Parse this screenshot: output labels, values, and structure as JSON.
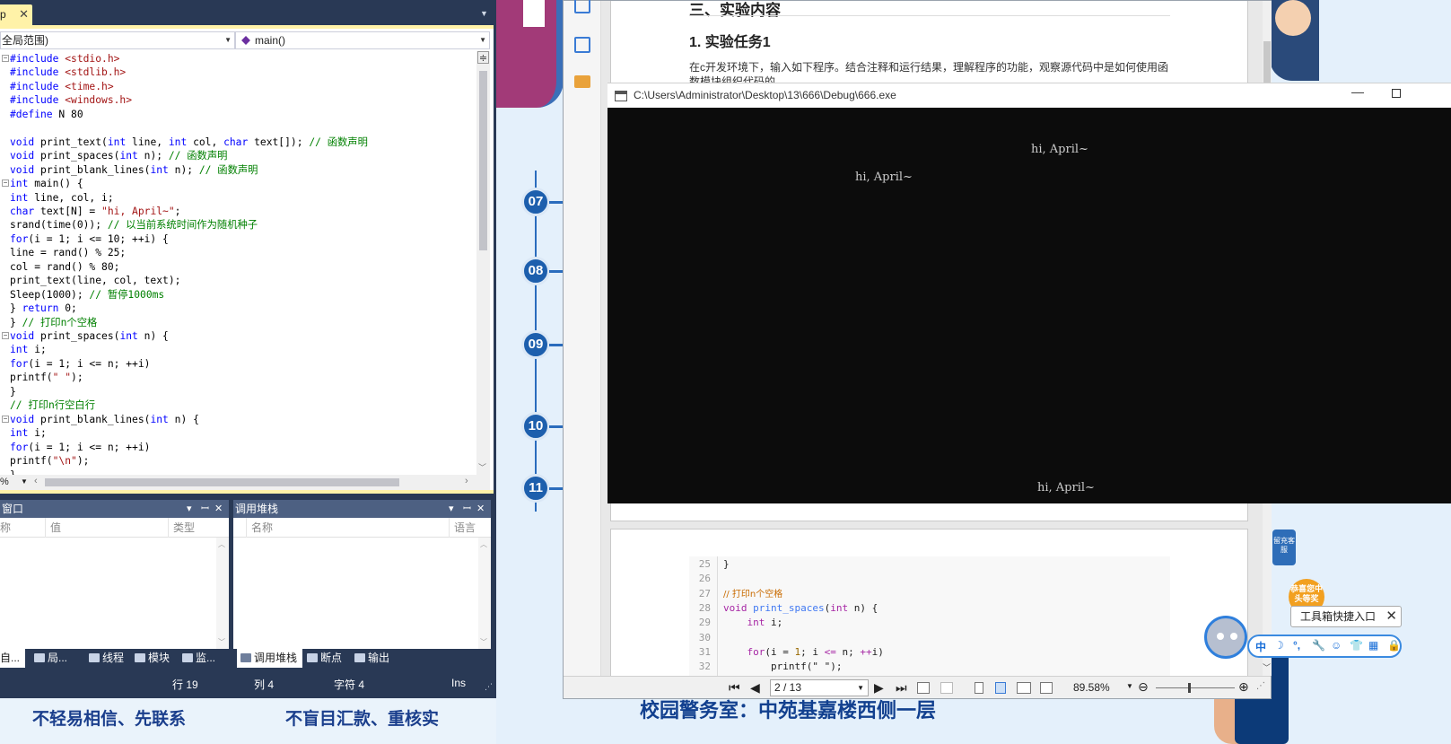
{
  "vs": {
    "tab_label": "p",
    "nav_scope": "全局范围)",
    "nav_function": "main()",
    "zoom": "%",
    "code": [
      {
        "fold": "−",
        "segs": [
          [
            "pp",
            "#include "
          ],
          [
            "str",
            "<stdio.h>"
          ]
        ]
      },
      {
        "segs": [
          [
            "pp",
            "#include "
          ],
          [
            "str",
            "<stdlib.h>"
          ]
        ]
      },
      {
        "segs": [
          [
            "pp",
            "#include "
          ],
          [
            "str",
            "<time.h>"
          ]
        ]
      },
      {
        "segs": [
          [
            "pp",
            "#include "
          ],
          [
            "str",
            "<windows.h>"
          ]
        ]
      },
      {
        "segs": [
          [
            "pp",
            "#define"
          ],
          [
            "",
            " N 80"
          ]
        ]
      },
      {
        "segs": []
      },
      {
        "segs": [
          [
            "kw",
            "void"
          ],
          [
            "",
            " print_text("
          ],
          [
            "kw",
            "int"
          ],
          [
            "",
            " line, "
          ],
          [
            "kw",
            "int"
          ],
          [
            "",
            " col, "
          ],
          [
            "kw",
            "char"
          ],
          [
            "",
            " text[]); "
          ],
          [
            "cm",
            "// 函数声明"
          ]
        ]
      },
      {
        "segs": [
          [
            "kw",
            "void"
          ],
          [
            "",
            " print_spaces("
          ],
          [
            "kw",
            "int"
          ],
          [
            "",
            " n); "
          ],
          [
            "cm",
            "// 函数声明"
          ]
        ]
      },
      {
        "segs": [
          [
            "kw",
            "void"
          ],
          [
            "",
            " print_blank_lines("
          ],
          [
            "kw",
            "int"
          ],
          [
            "",
            " n); "
          ],
          [
            "cm",
            "// 函数声明"
          ]
        ]
      },
      {
        "fold": "−",
        "segs": [
          [
            "kw",
            "int"
          ],
          [
            "",
            " main() {"
          ]
        ]
      },
      {
        "segs": [
          [
            "kw",
            "int"
          ],
          [
            "",
            " line, col, i;"
          ]
        ]
      },
      {
        "segs": [
          [
            "kw",
            "char"
          ],
          [
            "",
            " text[N] = "
          ],
          [
            "str",
            "\"hi, April~\""
          ],
          [
            "",
            ";"
          ]
        ]
      },
      {
        "segs": [
          [
            "",
            "srand(time(0)); "
          ],
          [
            "cm",
            "// 以当前系统时间作为随机种子"
          ]
        ]
      },
      {
        "segs": [
          [
            "kw",
            "for"
          ],
          [
            "",
            "(i = 1; i <= 10; ++i) {"
          ]
        ]
      },
      {
        "segs": [
          [
            "",
            "line = rand() % 25;"
          ]
        ]
      },
      {
        "segs": [
          [
            "",
            "col = rand() % 80;"
          ]
        ]
      },
      {
        "segs": [
          [
            "",
            "print_text(line, col, text);"
          ]
        ]
      },
      {
        "segs": [
          [
            "",
            "Sleep(1000); "
          ],
          [
            "cm",
            "// 暂停1000ms"
          ]
        ]
      },
      {
        "segs": [
          [
            "",
            "} "
          ],
          [
            "kw",
            "return"
          ],
          [
            "",
            " 0;"
          ]
        ]
      },
      {
        "segs": [
          [
            "",
            "} "
          ],
          [
            "cm",
            "// 打印n个空格"
          ]
        ]
      },
      {
        "fold": "−",
        "segs": [
          [
            "kw",
            "void"
          ],
          [
            "",
            " print_spaces("
          ],
          [
            "kw",
            "int"
          ],
          [
            "",
            " n) {"
          ]
        ]
      },
      {
        "segs": [
          [
            "kw",
            "int"
          ],
          [
            "",
            " i;"
          ]
        ]
      },
      {
        "segs": [
          [
            "kw",
            "for"
          ],
          [
            "",
            "(i = 1; i <= n; ++i)"
          ]
        ]
      },
      {
        "segs": [
          [
            "",
            "printf("
          ],
          [
            "str",
            "\" \""
          ],
          [
            "",
            ");"
          ]
        ]
      },
      {
        "segs": [
          [
            "",
            "}"
          ]
        ]
      },
      {
        "segs": [
          [
            "cm",
            "// 打印n行空白行"
          ]
        ]
      },
      {
        "fold": "−",
        "segs": [
          [
            "kw",
            "void"
          ],
          [
            "",
            " print_blank_lines("
          ],
          [
            "kw",
            "int"
          ],
          [
            "",
            " n) {"
          ]
        ]
      },
      {
        "segs": [
          [
            "kw",
            "int"
          ],
          [
            "",
            " i;"
          ]
        ]
      },
      {
        "segs": [
          [
            "kw",
            "for"
          ],
          [
            "",
            "(i = 1; i <= n; ++i)"
          ]
        ]
      },
      {
        "segs": [
          [
            "",
            "printf("
          ],
          [
            "str",
            "\"\\n\""
          ],
          [
            "",
            ");"
          ]
        ]
      },
      {
        "segs": [
          [
            "",
            "}"
          ]
        ]
      }
    ],
    "locals": {
      "title": "窗口",
      "col_name": "称",
      "col_value": "值",
      "col_type": "类型"
    },
    "callstack": {
      "title": "调用堆栈",
      "col_name": "名称",
      "col_lang": "语言"
    },
    "bottom_tabs_left": [
      "自...",
      "局...",
      "线程",
      "模块",
      "监..."
    ],
    "bottom_tabs_right": [
      "调用堆栈",
      "断点",
      "输出"
    ],
    "status": {
      "line": "行 19",
      "col": "列 4",
      "char": "字符 4",
      "mode": "Ins"
    }
  },
  "web": {
    "timeline": [
      "07",
      "08",
      "09",
      "10",
      "11"
    ],
    "bottom_left": [
      "不轻易相信、先联系",
      "不盲目汇款、重核实"
    ],
    "bottom_banner": "校园警务室：中苑基嘉楼西侧一层",
    "promo_top": "留充客服",
    "promo_bottom": "恭喜您中头等奖"
  },
  "pdf": {
    "heading": "三、实验内容",
    "subheading": "1. 实验任务1",
    "paragraph": "在c开发环境下，输入如下程序。结合注释和运行结果，理解程序的功能，观察源代码中是如何使用函数模块组织代码的",
    "code": [
      {
        "n": "25",
        "segs": [
          [
            "",
            "}"
          ]
        ]
      },
      {
        "n": "26",
        "segs": []
      },
      {
        "n": "27",
        "segs": [
          [
            "cm2",
            "// 打印n个空格"
          ]
        ]
      },
      {
        "n": "28",
        "segs": [
          [
            "kw2",
            "void"
          ],
          [
            "",
            " "
          ],
          [
            "fn2",
            "print_spaces"
          ],
          [
            "",
            "("
          ],
          [
            "kw2",
            "int"
          ],
          [
            "",
            " n) {"
          ]
        ]
      },
      {
        "n": "29",
        "segs": [
          [
            "",
            "    "
          ],
          [
            "kw2",
            "int"
          ],
          [
            "",
            " i;"
          ]
        ]
      },
      {
        "n": "30",
        "segs": []
      },
      {
        "n": "31",
        "segs": [
          [
            "",
            "    "
          ],
          [
            "kw2",
            "for"
          ],
          [
            "",
            "(i = "
          ],
          [
            "num2",
            "1"
          ],
          [
            "",
            "; i "
          ],
          [
            "op2",
            "<="
          ],
          [
            "",
            " n; "
          ],
          [
            "op2",
            "++"
          ],
          [
            "",
            "i)"
          ]
        ]
      },
      {
        "n": "32",
        "segs": [
          [
            "",
            "        printf(\" \");"
          ]
        ]
      }
    ],
    "page_indicator": "2 / 13",
    "zoom": "89.58%"
  },
  "console": {
    "title": "C:\\Users\\Administrator\\Desktop\\13\\666\\Debug\\666.exe",
    "outputs": [
      {
        "text": "hi, April~",
        "row": 1,
        "col": 50
      },
      {
        "text": "hi, April~",
        "row": 3,
        "col": 22
      },
      {
        "text": "hi, April~",
        "row": 25,
        "col": 51
      }
    ]
  },
  "toolbox": {
    "tip": "工具箱快捷入口",
    "ime_items": [
      "中",
      "☽",
      "°,",
      "🔧",
      "☺",
      "👕",
      "▦",
      "🔒"
    ]
  }
}
